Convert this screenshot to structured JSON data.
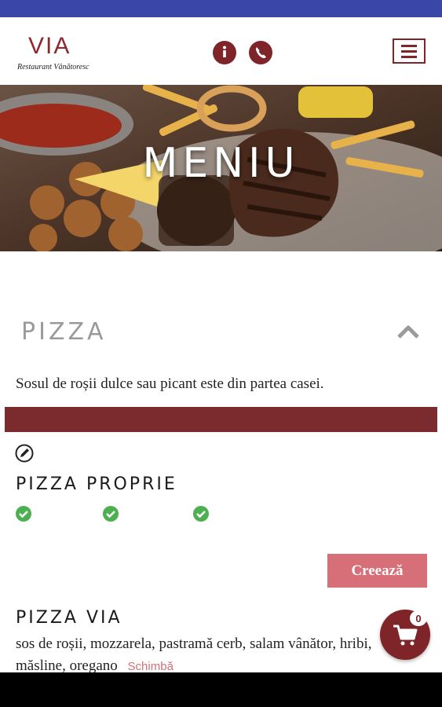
{
  "logo": {
    "name": "VIA",
    "tagline": "Restaurant Vânătoresc"
  },
  "header": {
    "info_icon": "info-icon",
    "phone_icon": "phone-icon",
    "menu_icon": "hamburger-icon"
  },
  "hero": {
    "title": "MENIU"
  },
  "category": {
    "title": "PIZZA",
    "description": "Sosul de roșii dulce sau picant este din partea casei."
  },
  "custom_pizza": {
    "title": "PIZZA PROPRIE",
    "checks": 3,
    "create_label": "Creează"
  },
  "pizza_via": {
    "title": "PIZZA VIA",
    "ingredients": "sos de roșii, mozzarela, pastramă cerb, salam vânător, hribi, măsline, oregano",
    "change_label": "Schimbă"
  },
  "cart": {
    "count": "0"
  },
  "colors": {
    "brand": "#7f2428",
    "accent": "#d66f77",
    "status_bar": "#3a47a8"
  }
}
